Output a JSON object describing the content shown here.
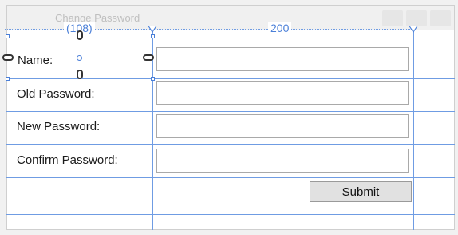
{
  "window": {
    "title": "Change Password"
  },
  "designer": {
    "column0_width": "(108)",
    "column1_width": "200"
  },
  "form": {
    "name_label": "Name:",
    "name_value": "",
    "old_password_label": "Old Password:",
    "old_password_value": "",
    "new_password_label": "New Password:",
    "new_password_value": "",
    "confirm_password_label": "Confirm Password:",
    "confirm_password_value": "",
    "submit_label": "Submit"
  },
  "colors": {
    "gridline": "#6f9ce3",
    "ruler_text": "#4a7fd8",
    "window_bg": "#ffffff",
    "button_bg": "#e1e1e1"
  }
}
